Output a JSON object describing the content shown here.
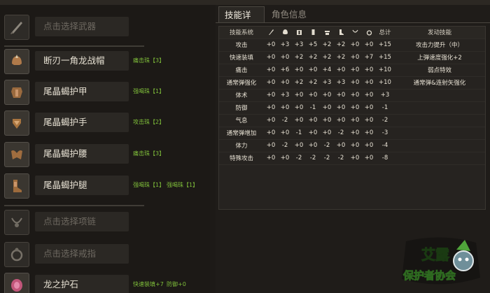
{
  "slots": [
    {
      "name": "点击选择武器",
      "empty": true,
      "icon": "blade-icon",
      "skills": []
    },
    {
      "name": "断刃一角龙战帽",
      "empty": false,
      "icon": "helmet-icon",
      "skills": [
        "痛击珠【3】"
      ]
    },
    {
      "name": "尾晶蝎护甲",
      "empty": false,
      "icon": "chest-armor-icon",
      "skills": [
        "强喝珠【1】"
      ]
    },
    {
      "name": "尾晶蝎护手",
      "empty": false,
      "icon": "gauntlet-icon",
      "skills": [
        "攻击珠【2】"
      ]
    },
    {
      "name": "尾晶蝎护腰",
      "empty": false,
      "icon": "waist-armor-icon",
      "skills": [
        "痛击珠【3】"
      ]
    },
    {
      "name": "尾晶蝎护腿",
      "empty": false,
      "icon": "leg-armor-icon",
      "skills": [
        "强喝珠【1】",
        "强喝珠【1】"
      ]
    },
    {
      "name": "点击选择项链",
      "empty": true,
      "icon": "necklace-icon",
      "skills": []
    },
    {
      "name": "点击选择戒指",
      "empty": true,
      "icon": "ring-icon",
      "skills": []
    },
    {
      "name": "龙之护石",
      "empty": false,
      "icon": "talisman-icon",
      "skills": [
        "快速装填+7",
        "防御+0"
      ]
    }
  ],
  "tabs": [
    {
      "label": "技能详情",
      "active": true
    },
    {
      "label": "角色信息",
      "active": false
    }
  ],
  "table": {
    "header_first": "技能系统",
    "header_icons": [
      "weapon-icon",
      "helmet-icon",
      "chest-icon",
      "arms-icon",
      "waist-icon",
      "legs-icon",
      "necklace-icon",
      "ring-icon"
    ],
    "header_total": "总计",
    "header_effect": "发动技能",
    "rows": [
      {
        "name": "攻击",
        "vals": [
          "+0",
          "+3",
          "+3",
          "+5",
          "+2",
          "+2",
          "+0",
          "+0"
        ],
        "total": "+15",
        "effect": "攻击力提升（中）"
      },
      {
        "name": "快速装填",
        "vals": [
          "+0",
          "+0",
          "+2",
          "+2",
          "+2",
          "+2",
          "+0",
          "+7"
        ],
        "total": "+15",
        "effect": "上弹速度强化+2"
      },
      {
        "name": "痛击",
        "vals": [
          "+0",
          "+6",
          "+0",
          "+0",
          "+4",
          "+0",
          "+0",
          "+0"
        ],
        "total": "+10",
        "effect": "弱点特效"
      },
      {
        "name": "通常弹强化",
        "vals": [
          "+0",
          "+0",
          "+2",
          "+2",
          "+3",
          "+3",
          "+0",
          "+0"
        ],
        "total": "+10",
        "effect": "通常弹&连射矢强化"
      },
      {
        "name": "体术",
        "vals": [
          "+0",
          "+3",
          "+0",
          "+0",
          "+0",
          "+0",
          "+0",
          "+0"
        ],
        "total": "+3",
        "effect": ""
      },
      {
        "name": "防御",
        "vals": [
          "+0",
          "+0",
          "+0",
          "-1",
          "+0",
          "+0",
          "+0",
          "+0"
        ],
        "total": "-1",
        "effect": ""
      },
      {
        "name": "气息",
        "vals": [
          "+0",
          "-2",
          "+0",
          "+0",
          "+0",
          "+0",
          "+0",
          "+0"
        ],
        "total": "-2",
        "effect": ""
      },
      {
        "name": "通常弹增加",
        "vals": [
          "+0",
          "+0",
          "-1",
          "+0",
          "+0",
          "-2",
          "+0",
          "+0"
        ],
        "total": "-3",
        "effect": ""
      },
      {
        "name": "体力",
        "vals": [
          "+0",
          "-2",
          "+0",
          "+0",
          "-2",
          "+0",
          "+0",
          "+0"
        ],
        "total": "-4",
        "effect": ""
      },
      {
        "name": "特殊攻击",
        "vals": [
          "+0",
          "+0",
          "-2",
          "-2",
          "-2",
          "-2",
          "+0",
          "+0"
        ],
        "total": "-8",
        "effect": ""
      }
    ]
  },
  "watermark": {
    "line1": "艾露",
    "line2": "保护者协会"
  },
  "colors": {
    "skill_green": "#7fbf3a",
    "panel": "#2b2824",
    "background": "#1d1a17"
  }
}
